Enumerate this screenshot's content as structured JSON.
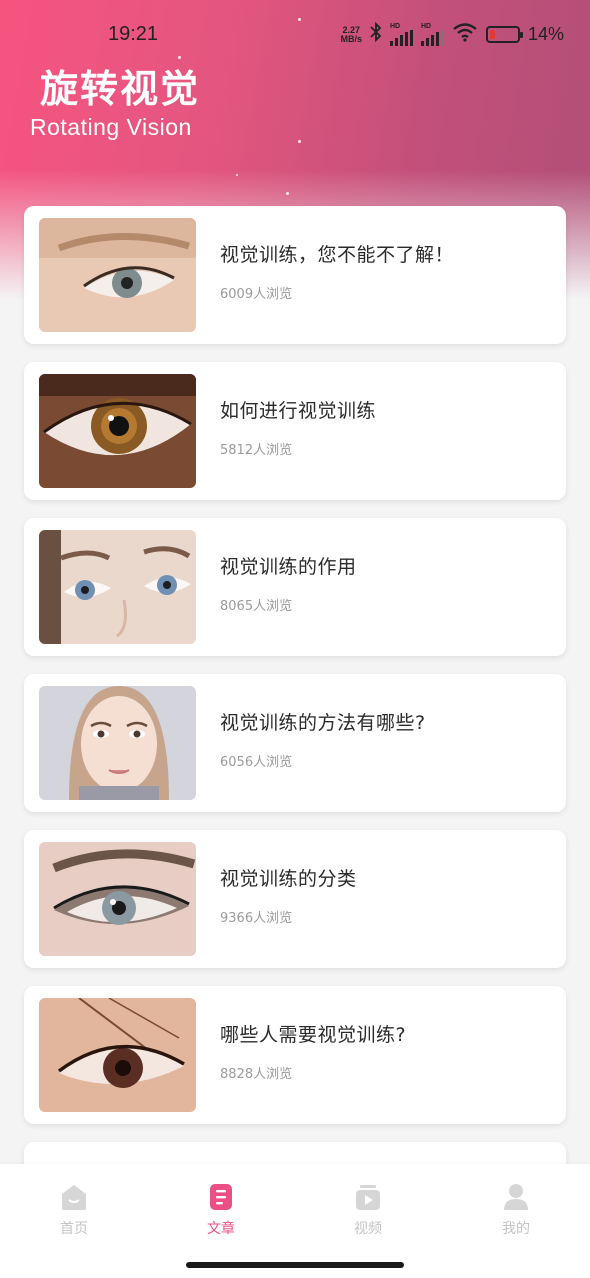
{
  "status_bar": {
    "time": "19:21",
    "net_speed_value": "2.27",
    "net_speed_unit": "MB/s",
    "hd_label": "HD",
    "battery_percent": "14%",
    "battery_level": 0.14,
    "icons": [
      "bluetooth-icon",
      "signal-icon",
      "signal-icon",
      "wifi-icon",
      "battery-icon"
    ]
  },
  "header": {
    "title": "旋转视觉",
    "subtitle": "Rotating Vision"
  },
  "articles": [
    {
      "title": "视觉训练，您不能不了解！",
      "views": "6009人浏览",
      "thumb": "eye-closeup-light"
    },
    {
      "title": "如何进行视觉训练",
      "views": "5812人浏览",
      "thumb": "eye-brown-iris"
    },
    {
      "title": "视觉训练的作用",
      "views": "8065人浏览",
      "thumb": "eyes-pair-blue"
    },
    {
      "title": "视觉训练的方法有哪些?",
      "views": "6056人浏览",
      "thumb": "face-portrait"
    },
    {
      "title": "视觉训练的分类",
      "views": "9366人浏览",
      "thumb": "eye-makeup-grey"
    },
    {
      "title": "哪些人需要视觉训练?",
      "views": "8828人浏览",
      "thumb": "eye-brown-lashes"
    }
  ],
  "bottom_nav": {
    "items": [
      {
        "label": "首页",
        "icon": "home-icon",
        "active": false
      },
      {
        "label": "文章",
        "icon": "article-icon",
        "active": true
      },
      {
        "label": "视频",
        "icon": "video-icon",
        "active": false
      },
      {
        "label": "我的",
        "icon": "profile-icon",
        "active": false
      }
    ]
  },
  "colors": {
    "brand_pink": "#f6547f",
    "active_nav": "#ec4f86",
    "inactive_nav": "#c4c4c4",
    "title_text": "#2b2b2b",
    "meta_text": "#9b9b9b"
  }
}
